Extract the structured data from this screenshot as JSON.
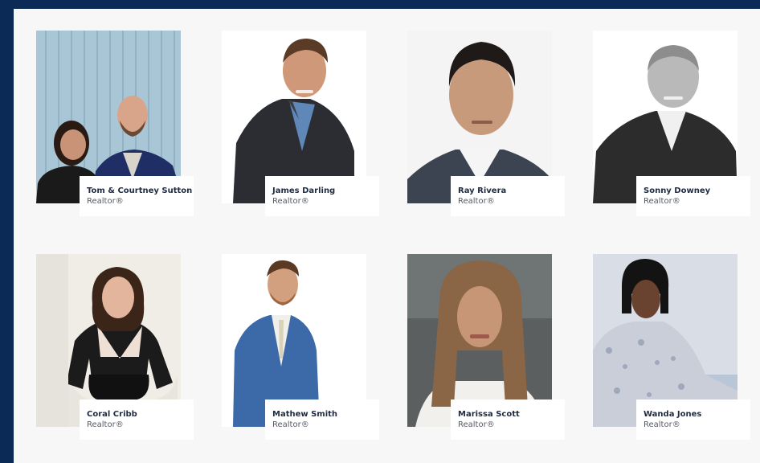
{
  "agents": [
    {
      "name": "Tom & Courtney Sutton",
      "title": "Realtor®",
      "photo_icon": "couple-portrait"
    },
    {
      "name": "James Darling",
      "title": "Realtor®",
      "photo_icon": "person-portrait"
    },
    {
      "name": "Ray Rivera",
      "title": "Realtor®",
      "photo_icon": "person-portrait"
    },
    {
      "name": "Sonny Downey",
      "title": "Realtor®",
      "photo_icon": "person-portrait"
    },
    {
      "name": "Coral Cribb",
      "title": "Realtor®",
      "photo_icon": "person-portrait"
    },
    {
      "name": "Mathew Smith",
      "title": "Realtor®",
      "photo_icon": "person-portrait"
    },
    {
      "name": "Marissa Scott",
      "title": "Realtor®",
      "photo_icon": "person-portrait"
    },
    {
      "name": "Wanda Jones",
      "title": "Realtor®",
      "photo_icon": "person-portrait"
    }
  ],
  "colors": {
    "frame": "#0b2a55",
    "panel": "#f7f7f8",
    "name_text": "#1e2b42"
  }
}
